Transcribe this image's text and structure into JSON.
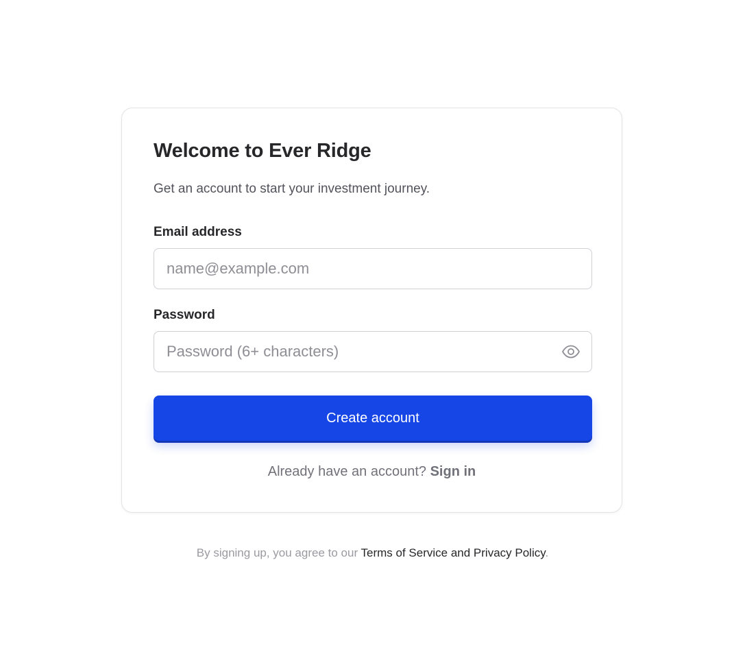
{
  "signup": {
    "title": "Welcome to Ever Ridge",
    "subtitle": "Get an account to start your investment journey.",
    "email": {
      "label": "Email address",
      "placeholder": "name@example.com",
      "value": ""
    },
    "password": {
      "label": "Password",
      "placeholder": "Password (6+ characters)",
      "value": "",
      "toggle_icon": "eye-icon"
    },
    "submit_label": "Create account",
    "signin_prompt": "Already have an account?",
    "signin_link": "Sign in"
  },
  "footer": {
    "prefix": "By signing up, you agree to our",
    "link": "Terms of Service and Privacy Policy",
    "suffix": "."
  },
  "colors": {
    "accent": "#1746e6",
    "text_dark": "#27272a",
    "text_muted": "#52525b",
    "border": "#cfcfd4"
  }
}
